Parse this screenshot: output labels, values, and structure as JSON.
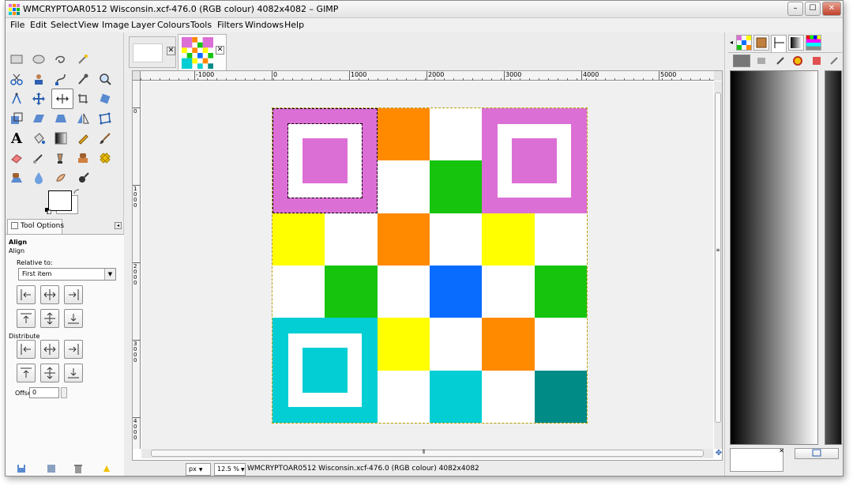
{
  "window": {
    "title": "WMCRYPTOAR0512 Wisconsin.xcf-476.0 (RGB colour) 4082x4082 – GIMP",
    "minimize_label": "–",
    "maximize_label": "☐",
    "close_label": "✕"
  },
  "menu": [
    "File",
    "Edit",
    "Select",
    "View",
    "Image",
    "Layer",
    "Colours",
    "Tools",
    "Filters",
    "Windows",
    "Help"
  ],
  "tool_options": {
    "tab_label": "Tool Options",
    "tool_name": "Align",
    "tool_subname": "Align",
    "relative_to_label": "Relative to:",
    "relative_to_value": "First item",
    "distribute_label": "Distribute",
    "offset_label": "Offset:",
    "offset_value": "0"
  },
  "ruler": {
    "h_labels": [
      "-1000",
      "0",
      "1000",
      "2000",
      "3000",
      "4000",
      "5000"
    ],
    "v_labels": [
      "0",
      "1000",
      "2000",
      "3000",
      "4000"
    ]
  },
  "status": {
    "unit": "px",
    "zoom": "12.5 %",
    "info": "WMCRYPTOAR0512 Wisconsin.xcf-476.0 (RGB colour) 4082x4082"
  },
  "colors": {
    "magenta": "#dc6fd5",
    "orange": "#ff8a00",
    "green": "#16c40e",
    "yellow": "#ffff00",
    "blue": "#0a6cff",
    "cyan": "#02ced3",
    "teal": "#008b87",
    "white": "#ffffff"
  },
  "grid": [
    [
      "magenta-finder",
      "magenta-finder",
      "orange",
      "white",
      "magenta-finder",
      "magenta-finder"
    ],
    [
      "magenta-finder",
      "magenta-finder",
      "white",
      "green",
      "magenta-finder",
      "magenta-finder"
    ],
    [
      "yellow",
      "white",
      "orange",
      "white",
      "yellow",
      "white"
    ],
    [
      "white",
      "green",
      "white",
      "blue",
      "white",
      "green"
    ],
    [
      "cyan-finder",
      "cyan-finder",
      "yellow",
      "white",
      "orange",
      "white"
    ],
    [
      "cyan-finder",
      "cyan-finder",
      "white",
      "cyan",
      "white",
      "teal"
    ]
  ]
}
